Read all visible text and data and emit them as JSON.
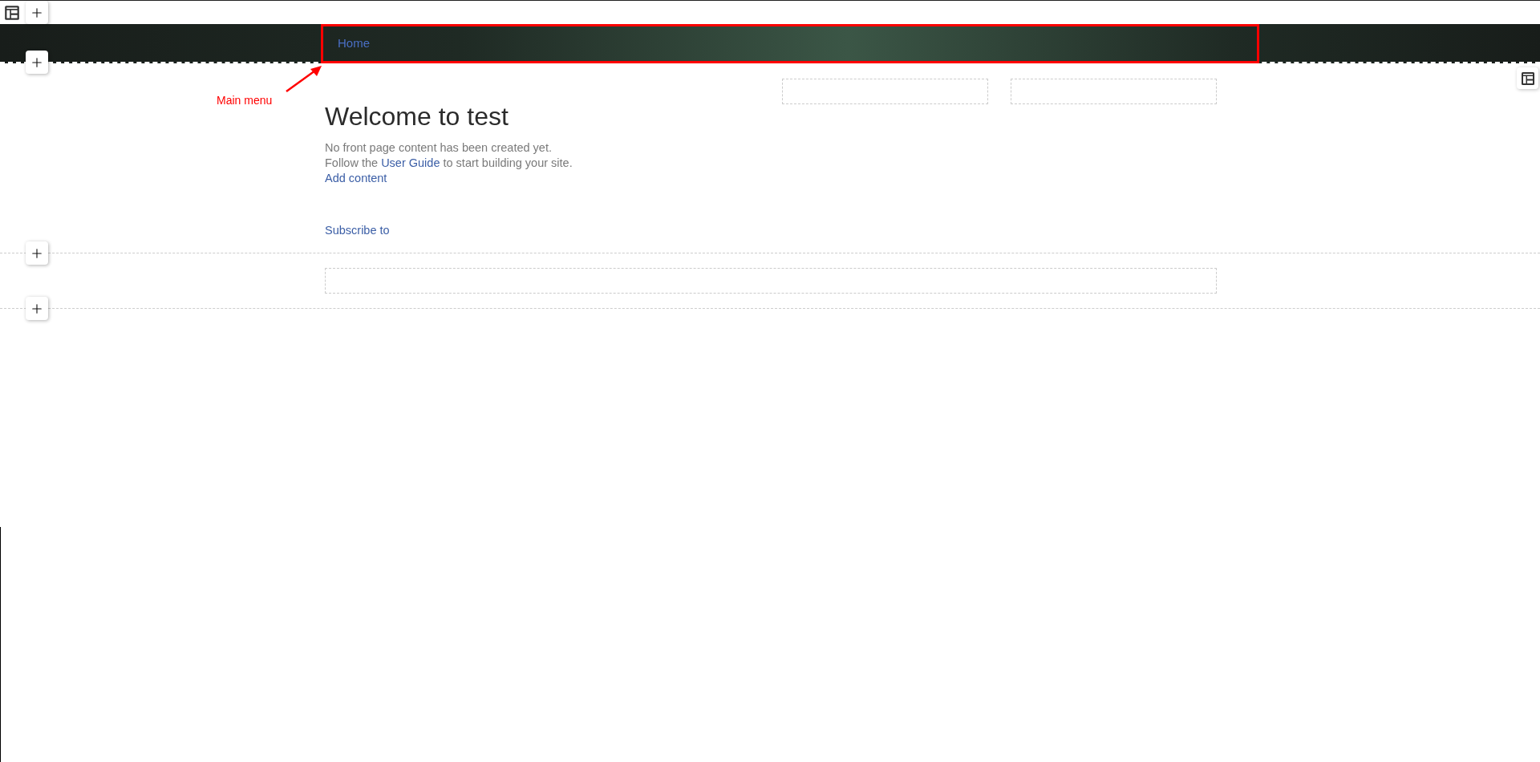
{
  "header": {
    "menu": [
      {
        "label": "Home"
      }
    ]
  },
  "annotation": {
    "label": "Main menu"
  },
  "content": {
    "title": "Welcome to test",
    "lines": [
      "No front page content has been created yet."
    ],
    "guide": {
      "before": "Follow the",
      "link": "User Guide",
      "after": "to start building your site."
    },
    "add_link": "Add content",
    "subscribe_link": "Subscribe to"
  }
}
